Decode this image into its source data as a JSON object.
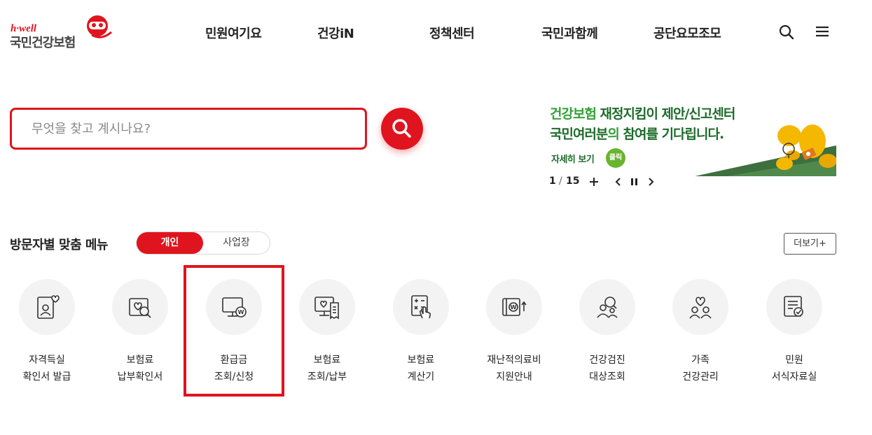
{
  "header": {
    "logo_en": "h·well",
    "logo_ko": "국민건강보험",
    "nav": [
      "민원여기요",
      "건강iN",
      "정책센터",
      "국민과함께",
      "공단요모조모"
    ],
    "search_icon": "search-icon",
    "menu_icon": "hamburger-menu-icon"
  },
  "search": {
    "placeholder": "무엇을 찾고 계시나요?",
    "button_icon": "search-icon"
  },
  "banner": {
    "line1_a": "건강보험 ",
    "line1_b": "재정지킴이 제안/신고센터",
    "line2_a": "국민여러분",
    "line2_b": "의 ",
    "line2_c": "참여를 기다립니다.",
    "more": "자세히 보기",
    "click": "클릭",
    "current": "1",
    "separator": "/",
    "total": "15",
    "colors": {
      "light_green": "#33a137",
      "dark_green": "#1d6b2a",
      "yellow": "#f5b800"
    }
  },
  "menu_section": {
    "title": "방문자별 맞춤 메뉴",
    "tab_personal": "개인",
    "tab_business": "사업장",
    "more": "더보기+",
    "items": [
      {
        "line1": "자격득실",
        "line2": "확인서 발급",
        "icon": "id-card-heart-icon"
      },
      {
        "line1": "보험료",
        "line2": "납부확인서",
        "icon": "document-search-icon"
      },
      {
        "line1": "환급금",
        "line2": "조회/신청",
        "icon": "monitor-won-icon"
      },
      {
        "line1": "보험료",
        "line2": "조회/납부",
        "icon": "monitor-receipt-icon"
      },
      {
        "line1": "보험료",
        "line2": "계산기",
        "icon": "calculator-hand-icon"
      },
      {
        "line1": "재난적의료비",
        "line2": "지원안내",
        "icon": "wallet-won-up-icon"
      },
      {
        "line1": "건강검진",
        "line2": "대상조회",
        "icon": "people-search-icon"
      },
      {
        "line1": "가족",
        "line2": "건강관리",
        "icon": "family-heart-icon"
      },
      {
        "line1": "민원",
        "line2": "서식자료실",
        "icon": "form-check-icon"
      }
    ]
  },
  "colors": {
    "brand_red": "#e0141e",
    "icon_bg": "#f3f3f3"
  }
}
